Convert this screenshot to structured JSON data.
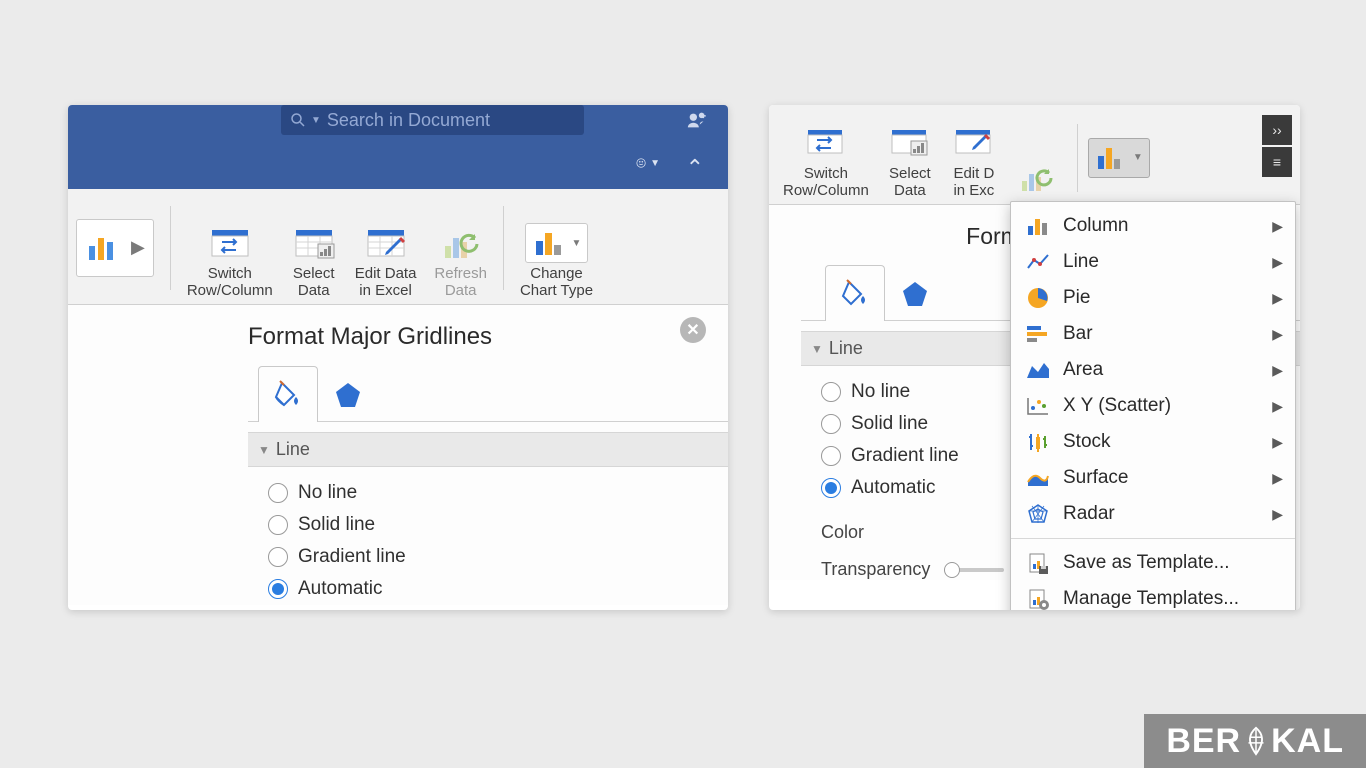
{
  "left": {
    "search_placeholder": "Search in Document",
    "ribbon": {
      "switch": "Switch\nRow/Column",
      "select": "Select\nData",
      "edit": "Edit Data\nin Excel",
      "refresh": "Refresh\nData",
      "change": "Change\nChart Type"
    },
    "panel": {
      "title": "Format Major Gridlines",
      "section": "Line",
      "options": [
        "No line",
        "Solid line",
        "Gradient line",
        "Automatic"
      ],
      "selected": "Automatic"
    }
  },
  "right": {
    "ribbon": {
      "switch": "Switch\nRow/Column",
      "select": "Select\nData",
      "edit": "Edit D\nin Exc"
    },
    "panel": {
      "title": "Format Major Gr",
      "section": "Line",
      "options": [
        "No line",
        "Solid line",
        "Gradient line",
        "Automatic"
      ],
      "selected": "Automatic",
      "color_label": "Color",
      "transparency_label": "Transparency"
    },
    "dropdown": {
      "items": [
        "Column",
        "Line",
        "Pie",
        "Bar",
        "Area",
        "X Y (Scatter)",
        "Stock",
        "Surface",
        "Radar"
      ],
      "footer": [
        "Save as Template...",
        "Manage Templates..."
      ]
    }
  },
  "watermark": {
    "pre": "BER",
    "post": "KAL"
  }
}
